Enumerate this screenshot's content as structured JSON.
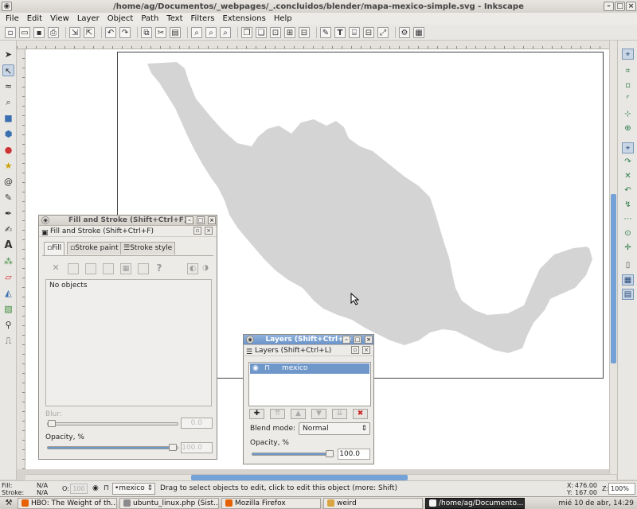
{
  "window": {
    "title": "/home/ag/Documentos/_webpages/_.concluidos/blender/mapa-mexico-simple.svg - Inkscape"
  },
  "menubar": [
    "File",
    "Edit",
    "View",
    "Layer",
    "Object",
    "Path",
    "Text",
    "Filters",
    "Extensions",
    "Help"
  ],
  "fill_stroke": {
    "window_title": "Fill and Stroke (Shift+Ctrl+F)",
    "header": "Fill and Stroke (Shift+Ctrl+F)",
    "tabs": [
      "Fill",
      "Stroke paint",
      "Stroke style"
    ],
    "paint_glyphs": {
      "none": "✕",
      "unknown": "?"
    },
    "message": "No objects",
    "blur_label": "Blur:",
    "blur_value": "0.0",
    "opacity_label": "Opacity, %",
    "opacity_value": "100.0"
  },
  "layers": {
    "window_title": "Layers (Shift+Ctrl+L)",
    "header": "Layers (Shift+Ctrl+L)",
    "rows": [
      {
        "name": "mexico",
        "selected": true
      }
    ],
    "blend_label": "Blend mode:",
    "blend_value": "Normal",
    "opacity_label": "Opacity, %",
    "opacity_value": "100.0"
  },
  "statusbar": {
    "fill_label": "Fill:",
    "fill_value": "N/A",
    "stroke_label": "Stroke:",
    "stroke_value": "N/A",
    "opacity_label": "O:",
    "opacity_value": "100",
    "layer_value": "•mexico",
    "message": "Drag to select objects to edit, click to edit this object (more: Shift)",
    "x_label": "X:",
    "x_value": "476.00",
    "y_label": "Y:",
    "y_value": "167.00",
    "zoom_label": "Z:",
    "zoom_value": "100%"
  },
  "taskbar": {
    "items": [
      {
        "label": "HBO: The Weight of th...",
        "active": false
      },
      {
        "label": "ubuntu_linux.php (Sist...",
        "active": false
      },
      {
        "label": "Mozilla Firefox",
        "active": false
      },
      {
        "label": "weird",
        "active": false
      },
      {
        "label": "/home/ag/Documento...",
        "active": true
      }
    ],
    "clock": "mié 10 de abr, 14:29"
  },
  "colors": {
    "map_fill": "#d4d4d4",
    "selection": "#6f97c9",
    "canvas": "#ffffff"
  }
}
